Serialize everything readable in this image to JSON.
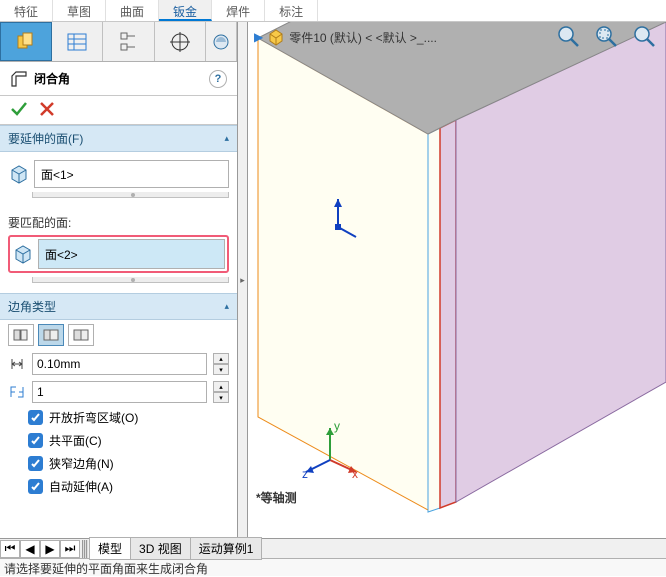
{
  "top_tabs": {
    "labels": [
      "特征",
      "草图",
      "曲面",
      "钣金",
      "焊件",
      "标注"
    ],
    "active_index": 3
  },
  "feature": {
    "title": "闭合角"
  },
  "sections": {
    "extend": {
      "header": "要延伸的面(F)",
      "face": "面<1>"
    },
    "match": {
      "header": "要匹配的面:",
      "face": "面<2>"
    },
    "corner": {
      "header": "边角类型"
    }
  },
  "spinners": {
    "gap": "0.10mm",
    "ratio": "1"
  },
  "checkboxes": [
    {
      "label": "开放折弯区域(O)",
      "checked": true
    },
    {
      "label": "共平面(C)",
      "checked": true
    },
    {
      "label": "狭窄边角(N)",
      "checked": true
    },
    {
      "label": "自动延伸(A)",
      "checked": true
    }
  ],
  "breadcrumb": {
    "part": "零件10 (默认) < <默认 >_...."
  },
  "view_label": "*等轴测",
  "bottom_tabs": {
    "labels": [
      "模型",
      "3D 视图",
      "运动算例1"
    ],
    "active_index": 0
  },
  "status": "请选择要延伸的平面角面来生成闭合角",
  "chart_data": null
}
